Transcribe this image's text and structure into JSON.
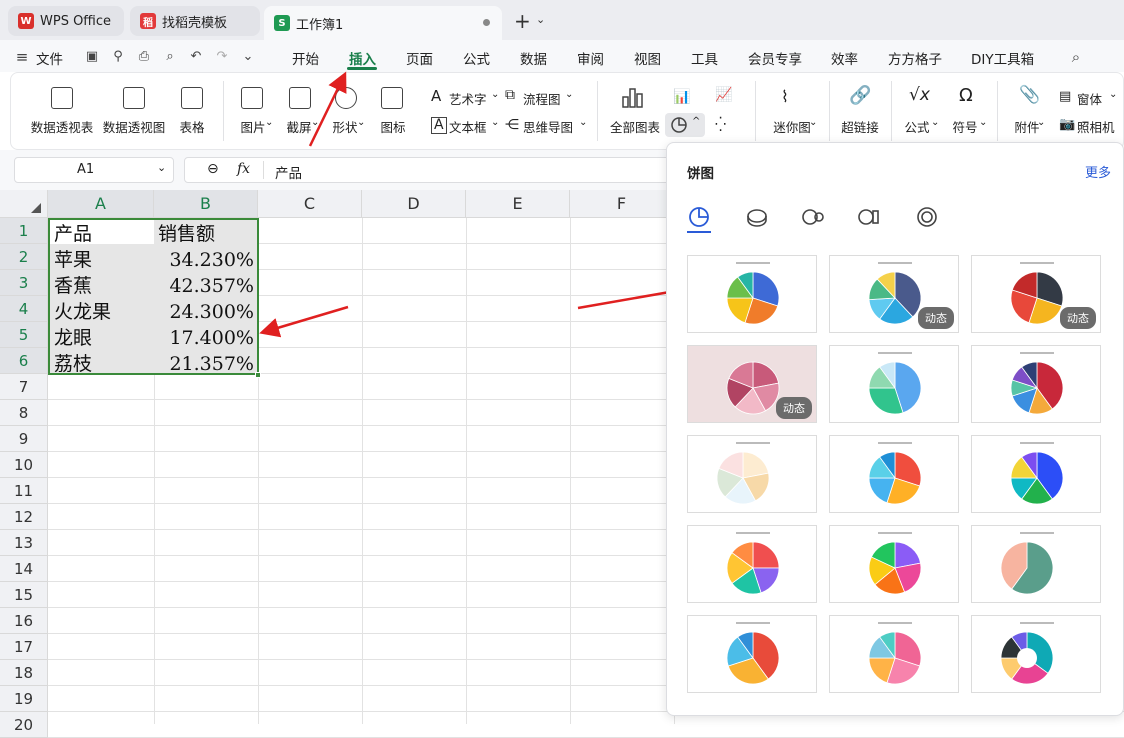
{
  "tabs": [
    {
      "label": "WPS Office",
      "logo": "W",
      "color": "#d9302c"
    },
    {
      "label": "找稻壳模板",
      "logo": "稻",
      "color": "#e2393a"
    },
    {
      "label": "工作簿1",
      "logo": "S",
      "color": "#1f9a53"
    }
  ],
  "menu": {
    "file": "文件",
    "items": [
      "开始",
      "插入",
      "页面",
      "公式",
      "数据",
      "审阅",
      "视图",
      "工具",
      "会员专享",
      "效率",
      "方方格子",
      "DIY工具箱"
    ],
    "active": "插入"
  },
  "ribbon": {
    "pivot_table": "数据透视表",
    "pivot_chart": "数据透视图",
    "table": "表格",
    "picture": "图片",
    "screenshot": "截屏",
    "shape": "形状",
    "icon": "图标",
    "wordart": "艺术字",
    "textbox": "文本框",
    "flowchart": "流程图",
    "mindmap": "思维导图",
    "all_charts": "全部图表",
    "sparkline": "迷你图",
    "hyperlink": "超链接",
    "formula": "公式",
    "symbol": "符号",
    "attachment": "附件",
    "form": "窗体",
    "camera": "照相机"
  },
  "formula_bar": {
    "name_box": "A1",
    "fx": "fx",
    "content": "产品"
  },
  "columns": [
    "A",
    "B",
    "C",
    "D",
    "E",
    "F"
  ],
  "rows": [
    "1",
    "2",
    "3",
    "4",
    "5",
    "6",
    "7",
    "8",
    "9",
    "10",
    "11",
    "12",
    "13",
    "14",
    "15",
    "16",
    "17",
    "18",
    "19",
    "20"
  ],
  "cells": [
    {
      "a": "产品",
      "b": "销售额"
    },
    {
      "a": "苹果",
      "b": "34.230%"
    },
    {
      "a": "香蕉",
      "b": "42.357%"
    },
    {
      "a": "火龙果",
      "b": "24.300%"
    },
    {
      "a": "龙眼",
      "b": "17.400%"
    },
    {
      "a": "荔枝",
      "b": "21.357%"
    }
  ],
  "panel": {
    "title": "饼图",
    "more": "更多",
    "badge": "动态"
  }
}
